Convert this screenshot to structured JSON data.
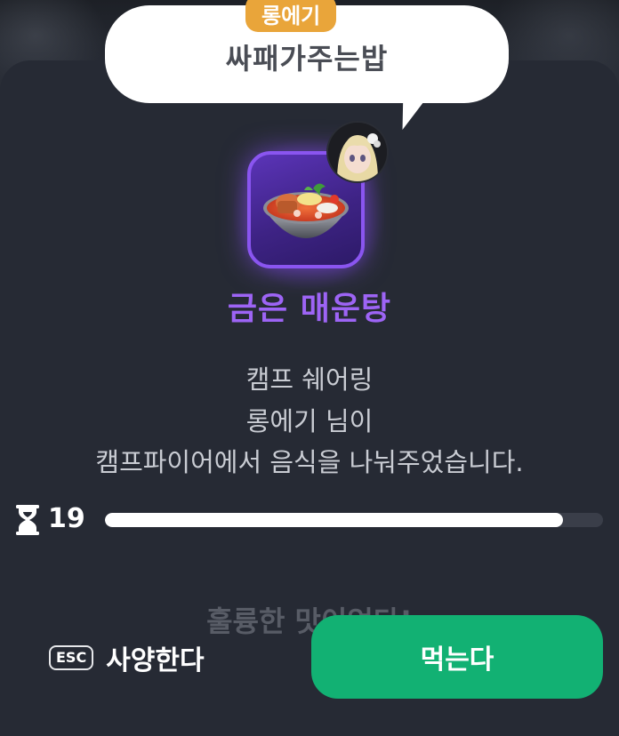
{
  "speech_bubble": {
    "sender_name": "롱에기",
    "message": "싸패가주는밥"
  },
  "item": {
    "name": "금은 매운탕",
    "icon": "spicy-fish-stew-bowl-icon",
    "frame_color": "#8a55f0",
    "name_color": "#9d64f5"
  },
  "description": {
    "line1": "캠프 쉐어링",
    "line2": "롱에기 님이",
    "line3": "캠프파이어에서 음식을 나눠주었습니다."
  },
  "timer": {
    "icon": "hourglass-icon",
    "seconds": "19",
    "progress_fraction": 0.92
  },
  "fading_message": "훌륭한 맛이었다!",
  "actions": {
    "decline_key": "ESC",
    "decline_label": "사양한다",
    "eat_label": "먹는다",
    "eat_color": "#12b173"
  }
}
